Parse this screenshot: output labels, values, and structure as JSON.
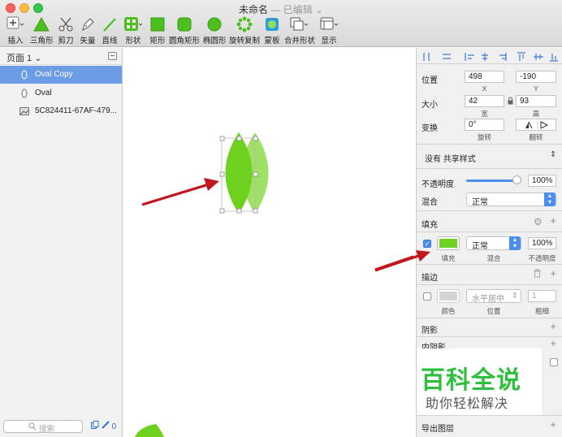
{
  "window": {
    "title": "未命名",
    "subtitle": "— 已编辑 ⌄"
  },
  "toolbar": {
    "items": [
      {
        "label": "插入",
        "icon": "plus-icon"
      },
      {
        "label": "三角形",
        "icon": "triangle-icon"
      },
      {
        "label": "剪刀",
        "icon": "scissors-icon"
      },
      {
        "label": "矢量",
        "icon": "pen-icon"
      },
      {
        "label": "直线",
        "icon": "line-icon"
      },
      {
        "label": "形状",
        "icon": "shapes-icon"
      },
      {
        "label": "矩形",
        "icon": "rectangle-icon"
      },
      {
        "label": "圆角矩形",
        "icon": "rounded-rect-icon"
      },
      {
        "label": "椭圆形",
        "icon": "oval-icon"
      },
      {
        "label": "旋转复制",
        "icon": "rotate-copy-icon"
      },
      {
        "label": "蒙板",
        "icon": "mask-icon"
      },
      {
        "label": "合并形状",
        "icon": "combine-icon"
      },
      {
        "label": "显示",
        "icon": "display-icon"
      }
    ],
    "accent": "#4dbf1f"
  },
  "layers": {
    "page_label": "页面 1 ⌄",
    "items": [
      {
        "name": "Oval Copy",
        "selected": true
      },
      {
        "name": "Oval",
        "selected": false
      },
      {
        "name": "5C824411-67AF-479...",
        "selected": false
      }
    ],
    "search_placeholder": "搜索",
    "bottom_badge": "0"
  },
  "inspector": {
    "position": {
      "label": "位置",
      "x": "498",
      "y": "-190",
      "x_cap": "X",
      "y_cap": "Y"
    },
    "size": {
      "label": "大小",
      "w": "42",
      "h": "93",
      "w_cap": "宽",
      "h_cap": "高"
    },
    "transform": {
      "label": "变换",
      "rotation": "0°",
      "rot_cap": "旋转",
      "flip_cap": "翻转"
    },
    "shared_style": "没有 共享样式",
    "opacity": {
      "label": "不透明度",
      "value": "100%",
      "level": 1.0
    },
    "blend": {
      "label": "混合",
      "value": "正常"
    },
    "fill": {
      "header": "填充",
      "color": "#6dd11d",
      "blend": "正常",
      "opacity": "100%",
      "cap_fill": "填充",
      "cap_blend": "混合",
      "cap_opacity": "不透明度"
    },
    "border": {
      "header": "描边",
      "position": "水平居中",
      "thickness": "1",
      "cap_color": "颜色",
      "cap_position": "位置",
      "cap_thickness": "粗细"
    },
    "shadow_header": "阴影",
    "inner_shadow_header": "内阴影",
    "export_header": "导出图层"
  },
  "watermark": {
    "title": "百科全说",
    "subtitle": "助你轻松解决"
  },
  "colors": {
    "leaf_dark": "#6dd11d",
    "leaf_light": "#9fe066",
    "arrow": "#c0161e",
    "selection_blue": "#6c9ce4"
  }
}
